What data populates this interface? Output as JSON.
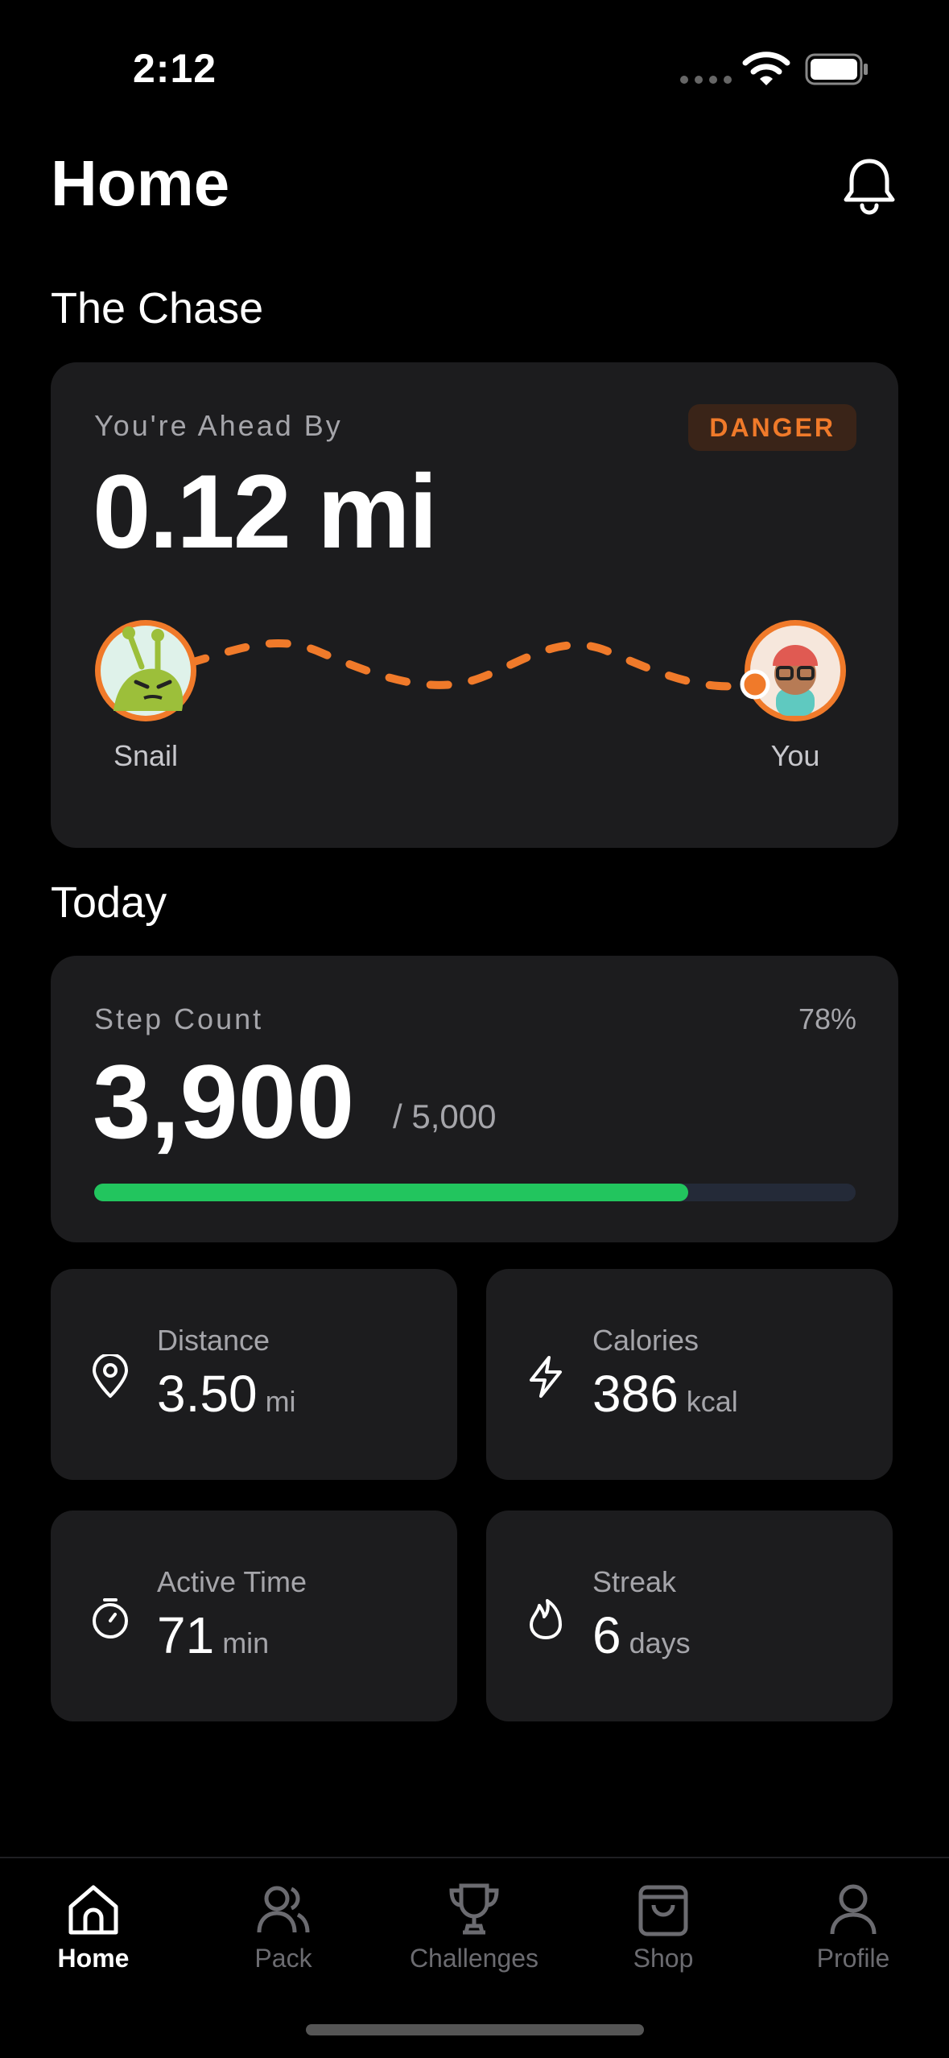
{
  "status": {
    "time": "2:12"
  },
  "header": {
    "title": "Home",
    "bell_icon": "bell-icon"
  },
  "chase": {
    "section_title": "The Chase",
    "label": "You're Ahead By",
    "badge": "DANGER",
    "distance": "0.12 mi",
    "left_name": "Snail",
    "right_name": "You",
    "accent": "#f07a2a"
  },
  "today": {
    "section_title": "Today",
    "steps": {
      "label": "Step Count",
      "percent": "78%",
      "value": "3,900",
      "goal": "/ 5,000",
      "progress": 0.78,
      "bar_color": "#22c55e"
    },
    "stats": [
      {
        "icon": "location-pin-icon",
        "label": "Distance",
        "value": "3.50",
        "unit": "mi"
      },
      {
        "icon": "lightning-icon",
        "label": "Calories",
        "value": "386",
        "unit": "kcal"
      },
      {
        "icon": "stopwatch-icon",
        "label": "Active Time",
        "value": "71",
        "unit": "min"
      },
      {
        "icon": "flame-icon",
        "label": "Streak",
        "value": "6",
        "unit": "days"
      }
    ]
  },
  "tabbar": {
    "items": [
      {
        "label": "Home",
        "icon": "home-icon",
        "active": true
      },
      {
        "label": "Pack",
        "icon": "users-icon",
        "active": false
      },
      {
        "label": "Challenges",
        "icon": "trophy-icon",
        "active": false
      },
      {
        "label": "Shop",
        "icon": "shopping-bag-icon",
        "active": false
      },
      {
        "label": "Profile",
        "icon": "user-icon",
        "active": false
      }
    ]
  }
}
